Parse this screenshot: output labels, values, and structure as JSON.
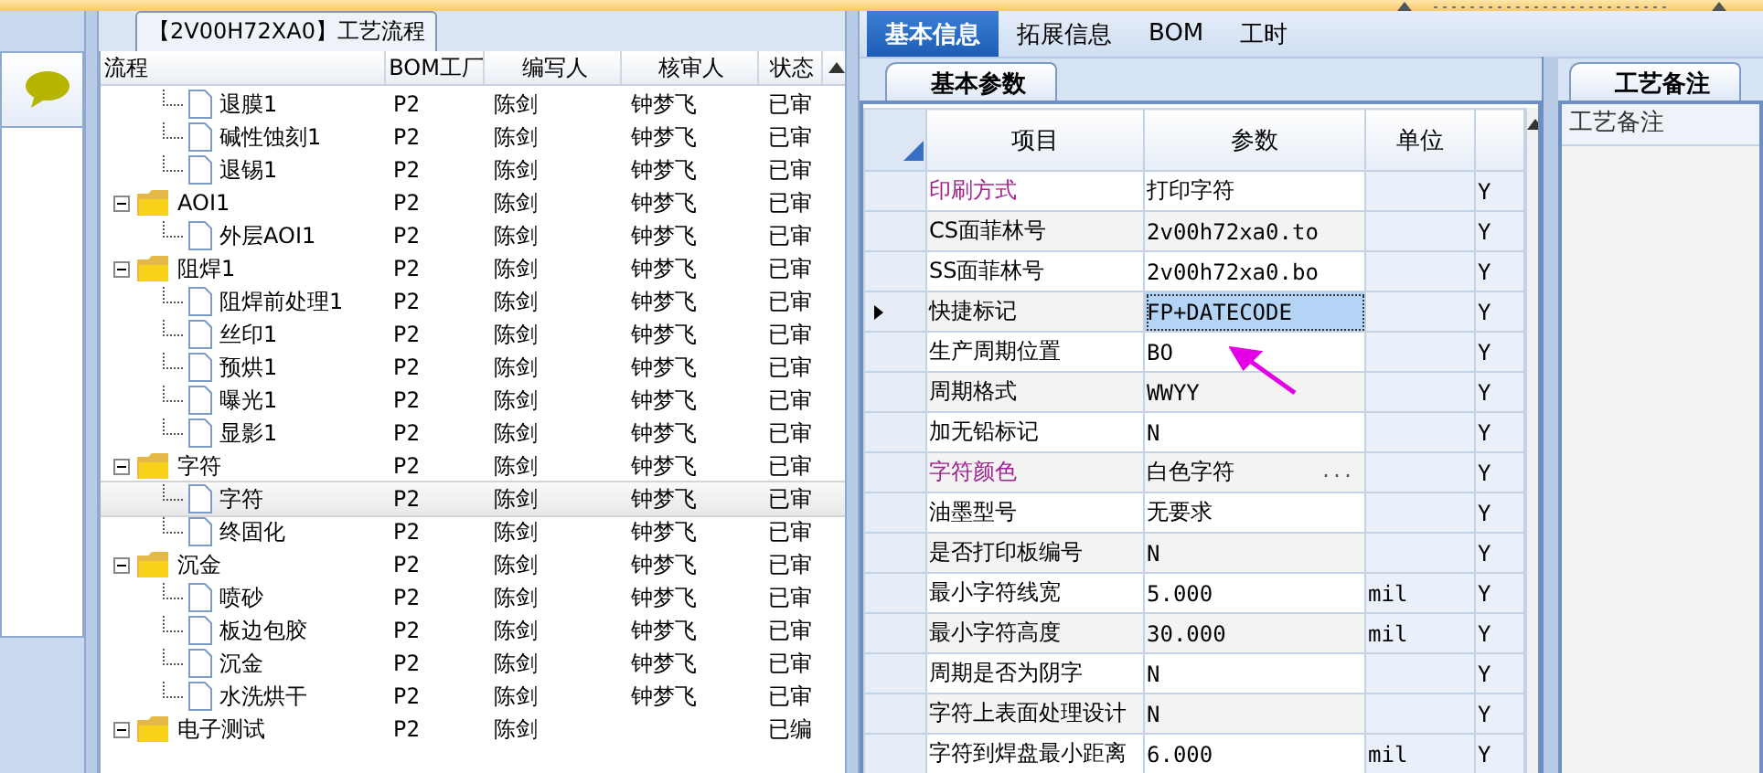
{
  "flow_panel": {
    "title": "【2V00H72XA0】工艺流程"
  },
  "tree": {
    "columns": [
      "流程",
      "BOM工厂",
      "编写人",
      "核审人",
      "状态"
    ],
    "rows": [
      {
        "kind": "file",
        "label": "退膜1",
        "factory": "P2",
        "author": "陈剑",
        "reviewer": "钟梦飞",
        "status": "已审",
        "selected": false
      },
      {
        "kind": "file",
        "label": "碱性蚀刻1",
        "factory": "P2",
        "author": "陈剑",
        "reviewer": "钟梦飞",
        "status": "已审",
        "selected": false
      },
      {
        "kind": "file",
        "label": "退锡1",
        "factory": "P2",
        "author": "陈剑",
        "reviewer": "钟梦飞",
        "status": "已审",
        "selected": false
      },
      {
        "kind": "folder",
        "label": "AOI1",
        "factory": "P2",
        "author": "陈剑",
        "reviewer": "钟梦飞",
        "status": "已审",
        "selected": false,
        "expanded": true,
        "children": [
          {
            "kind": "file",
            "label": "外层AOI1",
            "factory": "P2",
            "author": "陈剑",
            "reviewer": "钟梦飞",
            "status": "已审",
            "selected": false
          }
        ]
      },
      {
        "kind": "folder",
        "label": "阻焊1",
        "factory": "P2",
        "author": "陈剑",
        "reviewer": "钟梦飞",
        "status": "已审",
        "selected": false,
        "expanded": true,
        "children": [
          {
            "kind": "file",
            "label": "阻焊前处理1",
            "factory": "P2",
            "author": "陈剑",
            "reviewer": "钟梦飞",
            "status": "已审",
            "selected": false
          },
          {
            "kind": "file",
            "label": "丝印1",
            "factory": "P2",
            "author": "陈剑",
            "reviewer": "钟梦飞",
            "status": "已审",
            "selected": false
          },
          {
            "kind": "file",
            "label": "预烘1",
            "factory": "P2",
            "author": "陈剑",
            "reviewer": "钟梦飞",
            "status": "已审",
            "selected": false
          },
          {
            "kind": "file",
            "label": "曝光1",
            "factory": "P2",
            "author": "陈剑",
            "reviewer": "钟梦飞",
            "status": "已审",
            "selected": false
          },
          {
            "kind": "file",
            "label": "显影1",
            "factory": "P2",
            "author": "陈剑",
            "reviewer": "钟梦飞",
            "status": "已审",
            "selected": false
          }
        ]
      },
      {
        "kind": "folder",
        "label": "字符",
        "factory": "P2",
        "author": "陈剑",
        "reviewer": "钟梦飞",
        "status": "已审",
        "selected": false,
        "expanded": true,
        "children": [
          {
            "kind": "file",
            "label": "字符",
            "factory": "P2",
            "author": "陈剑",
            "reviewer": "钟梦飞",
            "status": "已审",
            "selected": true
          },
          {
            "kind": "file",
            "label": "终固化",
            "factory": "P2",
            "author": "陈剑",
            "reviewer": "钟梦飞",
            "status": "已审",
            "selected": false
          }
        ]
      },
      {
        "kind": "folder",
        "label": "沉金",
        "factory": "P2",
        "author": "陈剑",
        "reviewer": "钟梦飞",
        "status": "已审",
        "selected": false,
        "expanded": true,
        "children": [
          {
            "kind": "file",
            "label": "喷砂",
            "factory": "P2",
            "author": "陈剑",
            "reviewer": "钟梦飞",
            "status": "已审",
            "selected": false
          },
          {
            "kind": "file",
            "label": "板边包胶",
            "factory": "P2",
            "author": "陈剑",
            "reviewer": "钟梦飞",
            "status": "已审",
            "selected": false
          },
          {
            "kind": "file",
            "label": "沉金",
            "factory": "P2",
            "author": "陈剑",
            "reviewer": "钟梦飞",
            "status": "已审",
            "selected": false
          },
          {
            "kind": "file",
            "label": "水洗烘干",
            "factory": "P2",
            "author": "陈剑",
            "reviewer": "钟梦飞",
            "status": "已审",
            "selected": false
          }
        ]
      },
      {
        "kind": "folder",
        "label": "电子测试",
        "factory": "P2",
        "author": "陈剑",
        "status": "已编",
        "selected": false,
        "expanded": true
      }
    ]
  },
  "tabs": [
    {
      "label": "基本信息",
      "selected": true
    },
    {
      "label": "拓展信息",
      "selected": false
    },
    {
      "label": "BOM",
      "selected": false
    },
    {
      "label": "工时",
      "selected": false
    }
  ],
  "params_panel": {
    "tab": "基本参数",
    "columns": [
      "项目",
      "参数",
      "单位"
    ],
    "rows": [
      {
        "item": "印刷方式",
        "value": "打印字符",
        "highlighted": true,
        "current": false,
        "column_4": "Y"
      },
      {
        "item": "CS面菲林号",
        "value": "2v00h72xa0.to",
        "highlighted": false,
        "current": false,
        "column_4": "Y"
      },
      {
        "item": "SS面菲林号",
        "value": "2v00h72xa0.bo",
        "highlighted": false,
        "current": false,
        "column_4": "Y"
      },
      {
        "item": "快捷标记",
        "value": "FP+DATECODE",
        "highlighted": false,
        "current": true,
        "column_4": "Y"
      },
      {
        "item": "生产周期位置",
        "value": "BO",
        "highlighted": false,
        "current": false,
        "column_4": "Y"
      },
      {
        "item": "周期格式",
        "value": "WWYY",
        "highlighted": false,
        "current": false,
        "column_4": "Y"
      },
      {
        "item": "加无铅标记",
        "value": "N",
        "highlighted": false,
        "current": false,
        "column_4": "Y"
      },
      {
        "item": "字符颜色",
        "value": "白色字符",
        "button": "...",
        "highlighted": true,
        "current": false,
        "column_4": "Y"
      },
      {
        "item": "油墨型号",
        "value": "无要求",
        "highlighted": false,
        "current": false,
        "column_4": "Y"
      },
      {
        "item": "是否打印板编号",
        "value": "N",
        "highlighted": false,
        "current": false,
        "column_4": "Y"
      },
      {
        "item": "最小字符线宽",
        "value": "5.000",
        "unit": "mil",
        "highlighted": false,
        "current": false,
        "column_4": "Y"
      },
      {
        "item": "最小字符高度",
        "value": "30.000",
        "unit": "mil",
        "highlighted": false,
        "current": false,
        "column_4": "Y"
      },
      {
        "item": "周期是否为阴字",
        "value": "N",
        "highlighted": false,
        "current": false,
        "column_4": "Y"
      },
      {
        "item": "字符上表面处理设计",
        "value": "N",
        "highlighted": false,
        "current": false,
        "column_4": "Y"
      },
      {
        "item": "字符到焊盘最小距离",
        "value": "6.000",
        "unit": "mil",
        "highlighted": false,
        "current": false,
        "column_4": "Y"
      }
    ]
  },
  "notes_panel": {
    "tab": "工艺备注",
    "header": "工艺备注"
  }
}
